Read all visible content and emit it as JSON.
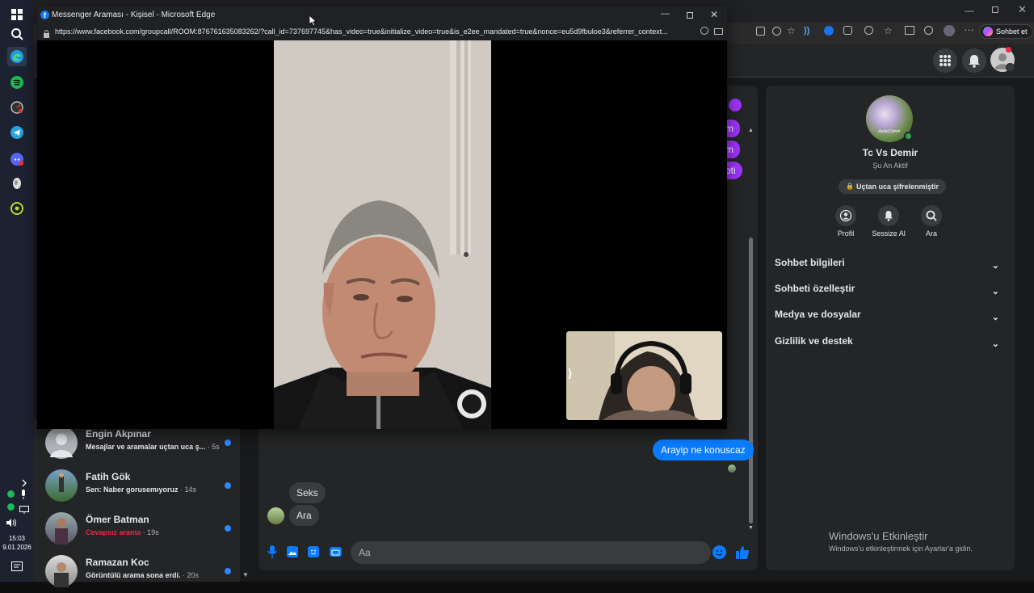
{
  "taskbar": {
    "time": "15:03",
    "date": "9.01.2026"
  },
  "background_browser": {
    "sohbet_button": "Sohbet et"
  },
  "call_window": {
    "title": "Messenger Araması - Kişisel - Microsoft Edge",
    "url": "https://www.facebook.com/groupcall/ROOM:876761635083262/?call_id=737697745&has_video=true&initialize_video=true&is_e2ee_mandated=true&nonce=eu5d9fbuloe3&referrer_context..."
  },
  "chat_list": [
    {
      "name": "Engin Akpınar",
      "message": "Mesajlar ve aramalar uçtan uca ş...",
      "time": "· 5s",
      "missed": false
    },
    {
      "name": "Fatih Gök",
      "message": "Sen: Naber gorusemıyoruz",
      "time": "· 14s",
      "missed": false
    },
    {
      "name": "Ömer Batman",
      "message": "Cevapsız arama",
      "time": "· 19s",
      "missed": true
    },
    {
      "name": "Ramazan Koc",
      "message": "Görüntülü arama sona erdi.",
      "time": "· 20s",
      "missed": false
    }
  ],
  "conversation": {
    "partial_bubbles": [
      "m",
      "m",
      "oti"
    ],
    "messages": [
      {
        "from": "me",
        "text": "Arayip ne konuscaz"
      },
      {
        "from": "them",
        "text": "Seks"
      },
      {
        "from": "them",
        "text": "Ara"
      }
    ],
    "composer_placeholder": "Aa"
  },
  "info_panel": {
    "avatar_caption": "Aysel Demir",
    "contact_name": "Tc Vs Demir",
    "status": "Şu An Aktif",
    "encryption_badge": "Uçtan uca şifrelenmiştir",
    "actions": [
      {
        "label": "Profil",
        "icon": "profile-icon"
      },
      {
        "label": "Sessize Al",
        "icon": "bell-icon"
      },
      {
        "label": "Ara",
        "icon": "search-icon"
      }
    ],
    "sections": [
      "Sohbet bilgileri",
      "Sohbeti özelleştir",
      "Medya ve dosyalar",
      "Gizlilik ve destek"
    ]
  },
  "watermark": {
    "title": "Windows'u Etkinleştir",
    "subtitle": "Windows'u etkinleştirmek için Ayarlar'a gidin."
  },
  "colors": {
    "messenger_blue": "#0a7cff",
    "purple_accent": "#a033ff",
    "missed_red": "#f02849",
    "active_green": "#31a24c"
  }
}
